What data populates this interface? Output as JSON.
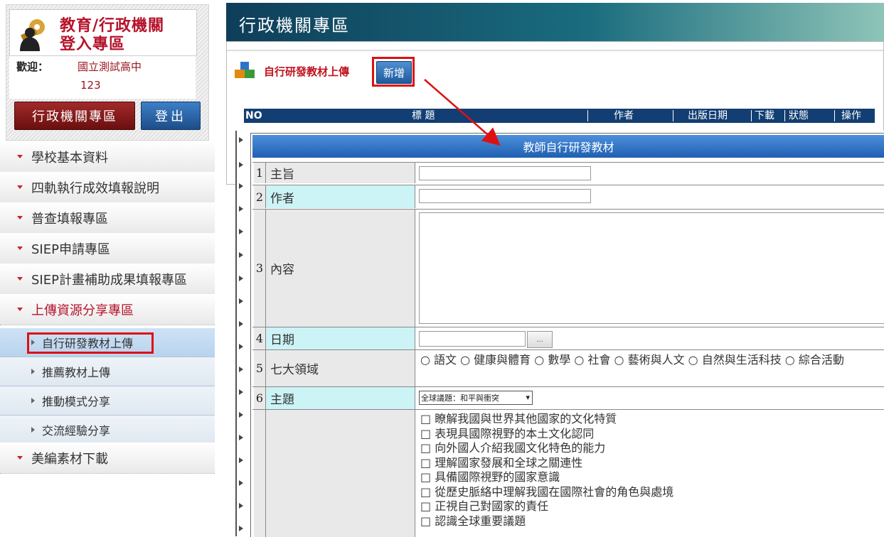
{
  "login": {
    "title_line1": "教育/行政機關",
    "title_line2": "登入專區",
    "welcome_label": "歡迎：",
    "school_name": "國立測試高中",
    "user_id": "123",
    "admin_button": "行政機關專區",
    "logout_button": "登出"
  },
  "menu": {
    "items": [
      {
        "label": "學校基本資料"
      },
      {
        "label": "四軌執行成效填報說明"
      },
      {
        "label": "普查填報專區"
      },
      {
        "label": "SIEP申請專區"
      },
      {
        "label": "SIEP計畫補助成果填報專區"
      },
      {
        "label": "上傳資源分享專區"
      }
    ],
    "sub_items": [
      {
        "label": "自行研發教材上傳"
      },
      {
        "label": "推薦教材上傳"
      },
      {
        "label": "推動模式分享"
      },
      {
        "label": "交流經驗分享"
      }
    ],
    "last_item": {
      "label": "美編素材下載"
    }
  },
  "header": {
    "title": "行政機關專區"
  },
  "section": {
    "title": "自行研發教材上傳",
    "new_button": "新增"
  },
  "list_header": {
    "no": "NO",
    "title": "標 題",
    "author": "作者",
    "date": "出版日期",
    "download": "下載",
    "status": "狀態",
    "action": "操作"
  },
  "form": {
    "title": "教師自行研發教材",
    "rows": [
      {
        "num": "1",
        "label": "主旨"
      },
      {
        "num": "2",
        "label": "作者"
      },
      {
        "num": "3",
        "label": "內容"
      },
      {
        "num": "4",
        "label": "日期"
      },
      {
        "num": "5",
        "label": "七大領域"
      },
      {
        "num": "6",
        "label": "主題"
      }
    ],
    "date_button": "...",
    "domains_text": "○ 語文 ○ 健康與體育 ○ 數學 ○ 社會 ○ 藝術與人文 ○ 自然與生活科技 ○ 綜合活動",
    "topic_selected": "全球議題：和平與衝突",
    "checklist": [
      "□ 瞭解我國與世界其他國家的文化特質",
      "□ 表現具國際視野的本土文化認同",
      "□ 向外國人介紹我國文化特色的能力",
      "□ 理解國家發展和全球之關連性",
      "□ 具備國際視野的國家意識",
      "□ 從歷史脈絡中理解我國在國際社會的角色與處境",
      "□ 正視自己對國家的責任",
      "□ 認識全球重要議題"
    ]
  },
  "colors": {
    "brand_red": "#b5132b",
    "header_dark": "#0e3e5a",
    "list_header_blue": "#123e73",
    "form_title_blue": "#2a6cc0",
    "label_cyan": "#ccf3f6",
    "highlight_red": "#dd1111"
  }
}
